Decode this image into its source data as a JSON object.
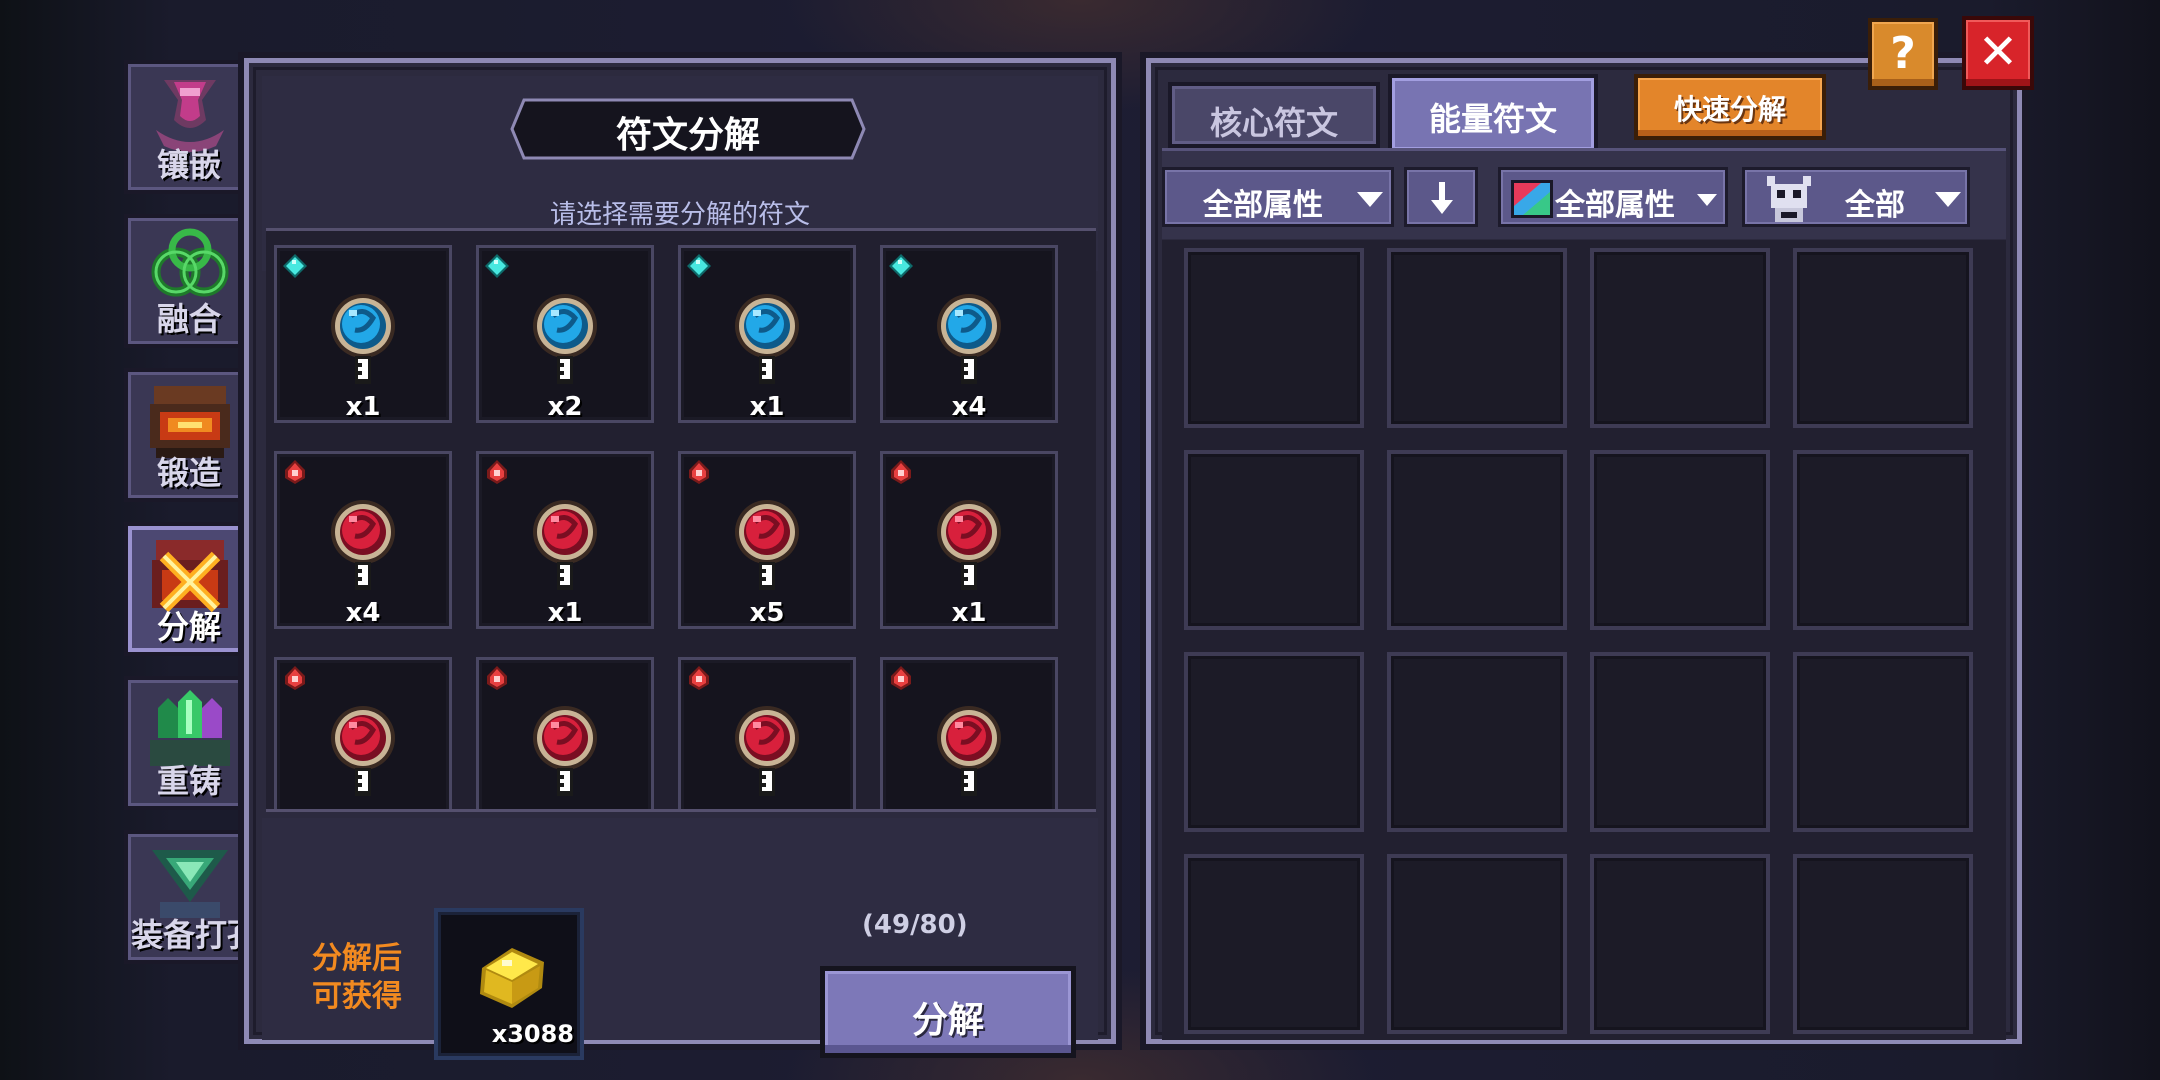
{
  "side_tabs": [
    {
      "label": "镶嵌",
      "icon": "inlay-icon"
    },
    {
      "label": "融合",
      "icon": "fusion-icon"
    },
    {
      "label": "锻造",
      "icon": "forge-icon"
    },
    {
      "label": "分解",
      "icon": "decompose-icon",
      "active": true
    },
    {
      "label": "重铸",
      "icon": "recast-icon"
    },
    {
      "label": "装备打孔",
      "icon": "socket-icon"
    }
  ],
  "left_panel": {
    "title": "符文分解",
    "subtitle": "请选择需要分解的符文",
    "runes": [
      {
        "type": "blue",
        "level": "3",
        "qty": "x1"
      },
      {
        "type": "blue",
        "level": "3",
        "qty": "x2"
      },
      {
        "type": "blue",
        "level": "3",
        "qty": "x1"
      },
      {
        "type": "blue",
        "level": "3",
        "qty": "x4"
      },
      {
        "type": "red",
        "level": "3",
        "qty": "x4"
      },
      {
        "type": "red",
        "level": "3",
        "qty": "x1"
      },
      {
        "type": "red",
        "level": "3",
        "qty": "x5"
      },
      {
        "type": "red",
        "level": "3",
        "qty": "x1"
      },
      {
        "type": "red",
        "level": "3",
        "qty": ""
      },
      {
        "type": "red",
        "level": "3",
        "qty": ""
      },
      {
        "type": "red",
        "level": "3",
        "qty": ""
      },
      {
        "type": "red",
        "level": "3",
        "qty": ""
      }
    ],
    "reward_label": "分解后可获得",
    "reward_amount": "x3088",
    "capacity": "(49/80)",
    "decompose_label": "分解"
  },
  "right_panel": {
    "tabs": [
      "核心符文",
      "能量符文"
    ],
    "active_tab": "能量符文",
    "quick_decompose": "快速分解",
    "filters": {
      "attr1": "全部属性",
      "sort_icon": "arrow-down-icon",
      "attr2": "全部属性",
      "class_filter": "全部"
    },
    "slot_count": 16
  },
  "help_label": "?",
  "close_label": "✕",
  "colors": {
    "panel_bg": "#2c2a3e",
    "panel_border": "#8e89b4",
    "button_primary": "#7d78b8",
    "button_orange": "#e3852a",
    "close_red": "#d8242a",
    "reward_text": "#f28a20",
    "rune_blue": "#22a8e8",
    "rune_red": "#d8203c"
  }
}
